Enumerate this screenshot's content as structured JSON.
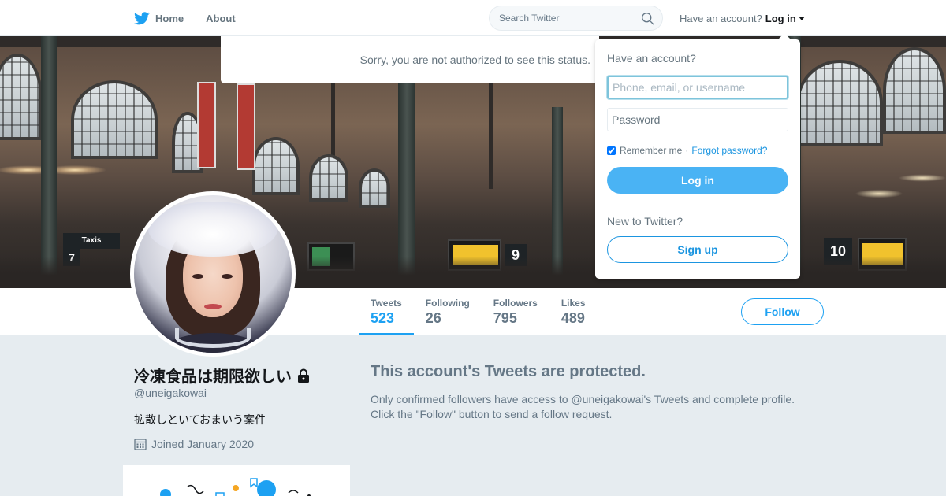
{
  "nav": {
    "home_label": "Home",
    "about_label": "About",
    "search_placeholder": "Search Twitter",
    "have_account": "Have an account?",
    "login_label": "Log in"
  },
  "status_notice": "Sorry, you are not authorized to see this status.",
  "login_dropdown": {
    "heading": "Have an account?",
    "username_placeholder": "Phone, email, or username",
    "password_placeholder": "Password",
    "remember_label": "Remember me",
    "separator": "·",
    "forgot_label": "Forgot password?",
    "login_button": "Log in",
    "new_to_twitter": "New to Twitter?",
    "signup_button": "Sign up"
  },
  "profile": {
    "name": "冷凍食品は期限欲しい",
    "handle": "@uneigakowai",
    "bio": "拡散しといておまいう案件",
    "joined": "Joined January 2020",
    "locked": true
  },
  "stats": [
    {
      "label": "Tweets",
      "value": "523",
      "active": true
    },
    {
      "label": "Following",
      "value": "26",
      "active": false
    },
    {
      "label": "Followers",
      "value": "795",
      "active": false
    },
    {
      "label": "Likes",
      "value": "489",
      "active": false
    }
  ],
  "follow_button": "Follow",
  "protected": {
    "title": "This account's Tweets are protected.",
    "line1": "Only confirmed followers have access to @uneigakowai's Tweets and complete profile.",
    "line2": "Click the \"Follow\" button to send a follow request."
  },
  "colors": {
    "brand_blue": "#1da1f2",
    "login_button_blue": "#4ab3f4",
    "page_background": "#e6ecf0",
    "muted_text": "#657786"
  },
  "icons": [
    "twitter-bird-icon",
    "search-icon",
    "chevron-down-icon",
    "lock-icon",
    "calendar-icon"
  ]
}
